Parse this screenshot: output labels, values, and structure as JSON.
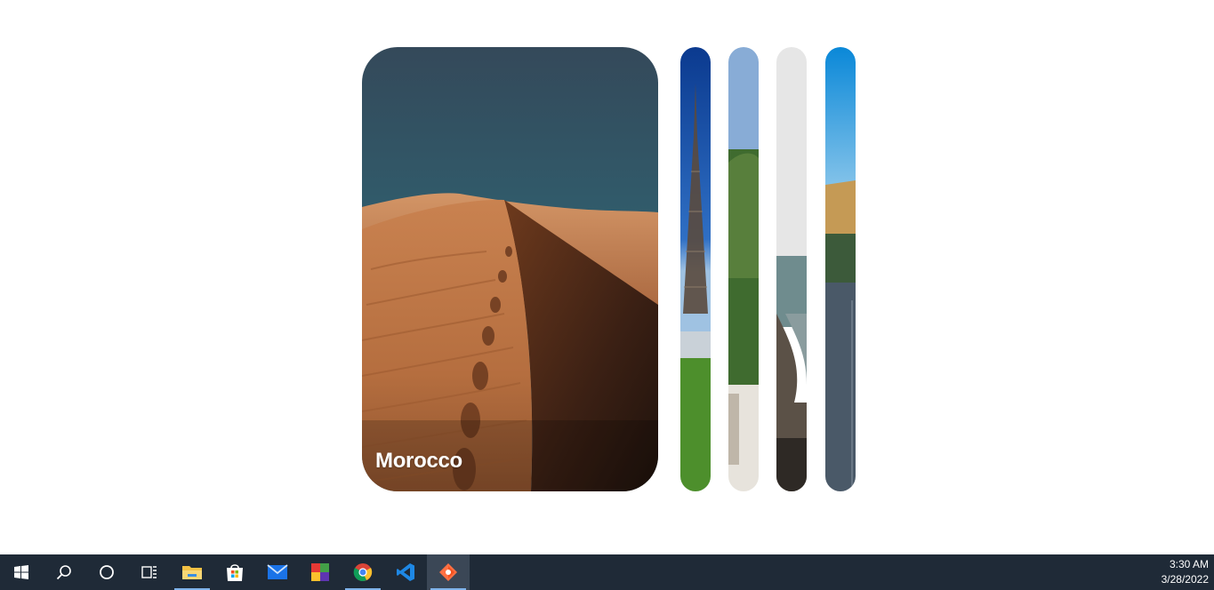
{
  "gallery": {
    "panels": [
      {
        "id": "morocco",
        "title": "Morocco",
        "expanded": true,
        "icon": "desert-dunes-photo"
      },
      {
        "id": "paris",
        "title": "",
        "expanded": false,
        "icon": "eiffel-tower-photo"
      },
      {
        "id": "garden",
        "title": "",
        "expanded": false,
        "icon": "garden-path-photo"
      },
      {
        "id": "lake",
        "title": "",
        "expanded": false,
        "icon": "river-canyon-photo"
      },
      {
        "id": "road",
        "title": "",
        "expanded": false,
        "icon": "mountain-road-photo"
      }
    ]
  },
  "taskbar": {
    "icons": [
      "windows-start-icon",
      "search-icon",
      "cortana-icon",
      "task-view-icon",
      "file-explorer-icon",
      "microsoft-store-icon",
      "mail-icon",
      "office-icon",
      "chrome-icon",
      "vscode-icon",
      "paint-app-icon"
    ],
    "time": "3:30 AM",
    "date": "3/28/2022"
  }
}
